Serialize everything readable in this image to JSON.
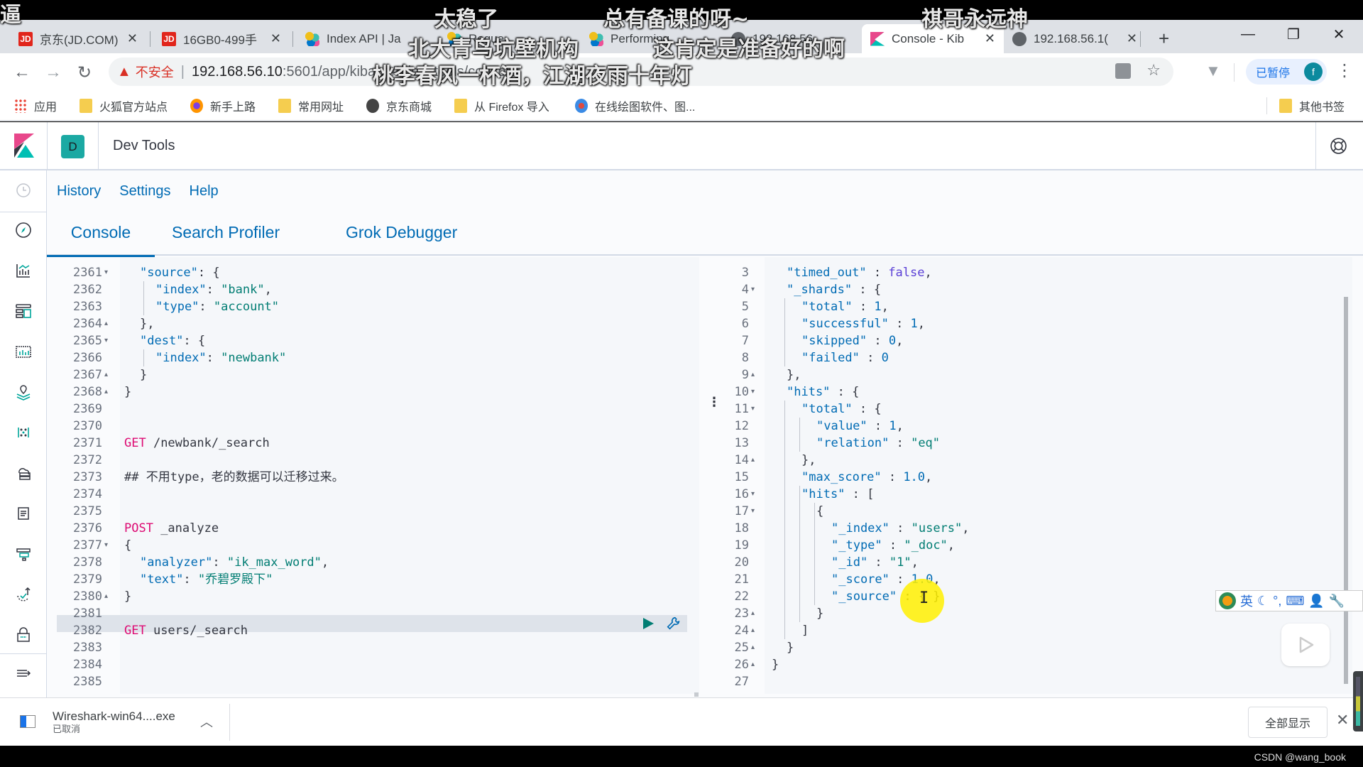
{
  "overlay_subtitles": [
    "逼",
    "太稳了",
    "总有备课的呀~",
    "祺哥永远神",
    "北大青鸟坑壁机构",
    "这肯定是准备好的啊",
    "桃李春风一杯酒，江湖夜雨十年灯"
  ],
  "browser": {
    "tabs": [
      {
        "title": "京东(JD.COM)",
        "icon": "jd-icon",
        "active": false
      },
      {
        "title": "16GB0-499手",
        "icon": "jd-icon",
        "active": false
      },
      {
        "title": "Index API | Ja",
        "icon": "elastic-icon",
        "active": false
      },
      {
        "title": "Reque",
        "icon": "elastic-icon",
        "active": false
      },
      {
        "title": "Performing",
        "icon": "elastic-icon",
        "active": false
      },
      {
        "title": "192.168.56",
        "icon": "globe-icon",
        "active": false
      },
      {
        "title": "Console - Kib",
        "icon": "kibana-icon",
        "active": true
      },
      {
        "title": "192.168.56.1(",
        "icon": "globe-icon",
        "active": false
      }
    ],
    "new_tab": "+",
    "window_controls": {
      "minimize": "—",
      "restore": "❐",
      "close": "✕"
    },
    "nav": {
      "back": "←",
      "forward": "→",
      "reload": "C"
    },
    "address": {
      "insecure_label": "不安全",
      "host": "192.168.56.10",
      "path": ":5601/app/kibana#/dev_tools/console"
    },
    "paused_label": "已暂停",
    "profile_initial": "f",
    "bookmarks": [
      {
        "label": "应用",
        "icon": "apps-icon"
      },
      {
        "label": "火狐官方站点",
        "icon": "folder-icon"
      },
      {
        "label": "新手上路",
        "icon": "firefox-icon"
      },
      {
        "label": "常用网址",
        "icon": "folder-icon"
      },
      {
        "label": "京东商城",
        "icon": "globe-icon"
      },
      {
        "label": "从 Firefox 导入",
        "icon": "folder-icon"
      },
      {
        "label": "在线绘图软件、图...",
        "icon": "draw-icon"
      }
    ],
    "other_bookmarks": "其他书签"
  },
  "kibana": {
    "space_initial": "D",
    "breadcrumb": "Dev Tools",
    "top_links": [
      "History",
      "Settings",
      "Help"
    ],
    "tabs": [
      {
        "label": "Console",
        "selected": true
      },
      {
        "label": "Search Profiler",
        "selected": false
      },
      {
        "label": "Grok Debugger",
        "selected": false
      }
    ],
    "sidebar_icons": [
      "recently-viewed-icon",
      "discover-icon",
      "visualize-icon",
      "dashboard-icon",
      "canvas-icon",
      "maps-icon",
      "machine-learning-icon",
      "infrastructure-icon",
      "logs-icon",
      "apm-icon",
      "uptime-icon",
      "siem-icon",
      "collapse-nav-icon"
    ]
  },
  "editor": {
    "lines": [
      {
        "n": "2361",
        "fold": "▾",
        "indent": 1,
        "tokens": [
          [
            "k",
            "\"source\""
          ],
          [
            "cm",
            ": {"
          ]
        ]
      },
      {
        "n": "2362",
        "fold": "",
        "indent": 2,
        "tokens": [
          [
            "k",
            "\"index\""
          ],
          [
            "cm",
            ": "
          ],
          [
            "s",
            "\"bank\""
          ],
          [
            "cm",
            ","
          ]
        ]
      },
      {
        "n": "2363",
        "fold": "",
        "indent": 2,
        "tokens": [
          [
            "k",
            "\"type\""
          ],
          [
            "cm",
            ": "
          ],
          [
            "s",
            "\"account\""
          ]
        ]
      },
      {
        "n": "2364",
        "fold": "▴",
        "indent": 1,
        "tokens": [
          [
            "cm",
            "},"
          ]
        ]
      },
      {
        "n": "2365",
        "fold": "▾",
        "indent": 1,
        "tokens": [
          [
            "k",
            "\"dest\""
          ],
          [
            "cm",
            ": {"
          ]
        ]
      },
      {
        "n": "2366",
        "fold": "",
        "indent": 2,
        "tokens": [
          [
            "k",
            "\"index\""
          ],
          [
            "cm",
            ": "
          ],
          [
            "s",
            "\"newbank\""
          ]
        ]
      },
      {
        "n": "2367",
        "fold": "▴",
        "indent": 1,
        "tokens": [
          [
            "cm",
            "}"
          ]
        ]
      },
      {
        "n": "2368",
        "fold": "▴",
        "indent": 0,
        "tokens": [
          [
            "cm",
            "}"
          ]
        ]
      },
      {
        "n": "2369",
        "fold": "",
        "indent": 0,
        "tokens": []
      },
      {
        "n": "2370",
        "fold": "",
        "indent": 0,
        "tokens": []
      },
      {
        "n": "2371",
        "fold": "",
        "indent": 0,
        "tokens": [
          [
            "m",
            "GET"
          ],
          [
            "cm",
            " /newbank/_search"
          ]
        ]
      },
      {
        "n": "2372",
        "fold": "",
        "indent": 0,
        "tokens": []
      },
      {
        "n": "2373",
        "fold": "",
        "indent": 0,
        "tokens": [
          [
            "cm",
            "## 不用type，老的数据可以迁移过来。"
          ]
        ]
      },
      {
        "n": "2374",
        "fold": "",
        "indent": 0,
        "tokens": []
      },
      {
        "n": "2375",
        "fold": "",
        "indent": 0,
        "tokens": []
      },
      {
        "n": "2376",
        "fold": "",
        "indent": 0,
        "tokens": [
          [
            "m",
            "POST"
          ],
          [
            "cm",
            " _analyze"
          ]
        ]
      },
      {
        "n": "2377",
        "fold": "▾",
        "indent": 0,
        "tokens": [
          [
            "cm",
            "{"
          ]
        ]
      },
      {
        "n": "2378",
        "fold": "",
        "indent": 1,
        "tokens": [
          [
            "k",
            "\"analyzer\""
          ],
          [
            "cm",
            ": "
          ],
          [
            "s",
            "\"ik_max_word\""
          ],
          [
            "cm",
            ","
          ]
        ]
      },
      {
        "n": "2379",
        "fold": "",
        "indent": 1,
        "tokens": [
          [
            "k",
            "\"text\""
          ],
          [
            "cm",
            ": "
          ],
          [
            "s",
            "\"乔碧罗殿下\""
          ]
        ]
      },
      {
        "n": "2380",
        "fold": "▴",
        "indent": 0,
        "tokens": [
          [
            "cm",
            "}"
          ]
        ]
      },
      {
        "n": "2381",
        "fold": "",
        "indent": 0,
        "tokens": []
      },
      {
        "n": "2382",
        "fold": "",
        "indent": 0,
        "tokens": [
          [
            "m",
            "GET"
          ],
          [
            "cm",
            " users/_search"
          ]
        ]
      },
      {
        "n": "2383",
        "fold": "",
        "indent": 0,
        "tokens": []
      },
      {
        "n": "2384",
        "fold": "",
        "indent": 0,
        "tokens": []
      },
      {
        "n": "2385",
        "fold": "",
        "indent": 0,
        "tokens": []
      }
    ],
    "active_line": "2382"
  },
  "output": {
    "lines": [
      {
        "n": "3",
        "fold": "",
        "indent": 1,
        "tokens": [
          [
            "k",
            "\"timed_out\""
          ],
          [
            "cm",
            " : "
          ],
          [
            "b",
            "false"
          ],
          [
            "cm",
            ","
          ]
        ]
      },
      {
        "n": "4",
        "fold": "▾",
        "indent": 1,
        "tokens": [
          [
            "k",
            "\"_shards\""
          ],
          [
            "cm",
            " : {"
          ]
        ]
      },
      {
        "n": "5",
        "fold": "",
        "indent": 2,
        "tokens": [
          [
            "k",
            "\"total\""
          ],
          [
            "cm",
            " : "
          ],
          [
            "n",
            "1"
          ],
          [
            "cm",
            ","
          ]
        ]
      },
      {
        "n": "6",
        "fold": "",
        "indent": 2,
        "tokens": [
          [
            "k",
            "\"successful\""
          ],
          [
            "cm",
            " : "
          ],
          [
            "n",
            "1"
          ],
          [
            "cm",
            ","
          ]
        ]
      },
      {
        "n": "7",
        "fold": "",
        "indent": 2,
        "tokens": [
          [
            "k",
            "\"skipped\""
          ],
          [
            "cm",
            " : "
          ],
          [
            "n",
            "0"
          ],
          [
            "cm",
            ","
          ]
        ]
      },
      {
        "n": "8",
        "fold": "",
        "indent": 2,
        "tokens": [
          [
            "k",
            "\"failed\""
          ],
          [
            "cm",
            " : "
          ],
          [
            "n",
            "0"
          ]
        ]
      },
      {
        "n": "9",
        "fold": "▴",
        "indent": 1,
        "tokens": [
          [
            "cm",
            "},"
          ]
        ]
      },
      {
        "n": "10",
        "fold": "▾",
        "indent": 1,
        "tokens": [
          [
            "k",
            "\"hits\""
          ],
          [
            "cm",
            " : {"
          ]
        ]
      },
      {
        "n": "11",
        "fold": "▾",
        "indent": 2,
        "tokens": [
          [
            "k",
            "\"total\""
          ],
          [
            "cm",
            " : {"
          ]
        ]
      },
      {
        "n": "12",
        "fold": "",
        "indent": 3,
        "tokens": [
          [
            "k",
            "\"value\""
          ],
          [
            "cm",
            " : "
          ],
          [
            "n",
            "1"
          ],
          [
            "cm",
            ","
          ]
        ]
      },
      {
        "n": "13",
        "fold": "",
        "indent": 3,
        "tokens": [
          [
            "k",
            "\"relation\""
          ],
          [
            "cm",
            " : "
          ],
          [
            "s",
            "\"eq\""
          ]
        ]
      },
      {
        "n": "14",
        "fold": "▴",
        "indent": 2,
        "tokens": [
          [
            "cm",
            "},"
          ]
        ]
      },
      {
        "n": "15",
        "fold": "",
        "indent": 2,
        "tokens": [
          [
            "k",
            "\"max_score\""
          ],
          [
            "cm",
            " : "
          ],
          [
            "n",
            "1.0"
          ],
          [
            "cm",
            ","
          ]
        ]
      },
      {
        "n": "16",
        "fold": "▾",
        "indent": 2,
        "tokens": [
          [
            "k",
            "\"hits\""
          ],
          [
            "cm",
            " : ["
          ]
        ]
      },
      {
        "n": "17",
        "fold": "▾",
        "indent": 3,
        "tokens": [
          [
            "cm",
            "{"
          ]
        ]
      },
      {
        "n": "18",
        "fold": "",
        "indent": 4,
        "tokens": [
          [
            "k",
            "\"_index\""
          ],
          [
            "cm",
            " : "
          ],
          [
            "s",
            "\"users\""
          ],
          [
            "cm",
            ","
          ]
        ]
      },
      {
        "n": "19",
        "fold": "",
        "indent": 4,
        "tokens": [
          [
            "k",
            "\"_type\""
          ],
          [
            "cm",
            " : "
          ],
          [
            "s",
            "\"_doc\""
          ],
          [
            "cm",
            ","
          ]
        ]
      },
      {
        "n": "20",
        "fold": "",
        "indent": 4,
        "tokens": [
          [
            "k",
            "\"_id\""
          ],
          [
            "cm",
            " : "
          ],
          [
            "s",
            "\"1\""
          ],
          [
            "cm",
            ","
          ]
        ]
      },
      {
        "n": "21",
        "fold": "",
        "indent": 4,
        "tokens": [
          [
            "k",
            "\"_score\""
          ],
          [
            "cm",
            " : "
          ],
          [
            "n",
            "1.0"
          ],
          [
            "cm",
            ","
          ]
        ]
      },
      {
        "n": "22",
        "fold": "",
        "indent": 4,
        "tokens": [
          [
            "k",
            "\"_source\""
          ],
          [
            "cm",
            " : { }"
          ]
        ]
      },
      {
        "n": "23",
        "fold": "▴",
        "indent": 3,
        "tokens": [
          [
            "cm",
            "}"
          ]
        ]
      },
      {
        "n": "24",
        "fold": "▴",
        "indent": 2,
        "tokens": [
          [
            "cm",
            "]"
          ]
        ]
      },
      {
        "n": "25",
        "fold": "▴",
        "indent": 1,
        "tokens": [
          [
            "cm",
            "}"
          ]
        ]
      },
      {
        "n": "26",
        "fold": "▴",
        "indent": 0,
        "tokens": [
          [
            "cm",
            "}"
          ]
        ]
      },
      {
        "n": "27",
        "fold": "",
        "indent": 0,
        "tokens": []
      }
    ]
  },
  "ime_toolbar": {
    "mode": "英",
    "items": [
      "moon-icon",
      "punctuation-icon",
      "keyboard-icon",
      "user-icon",
      "wrench-icon"
    ]
  },
  "download": {
    "filename": "Wireshark-win64....exe",
    "status": "已取消",
    "show_all": "全部显示",
    "close": "✕"
  },
  "watermark": "CSDN @wang_book"
}
